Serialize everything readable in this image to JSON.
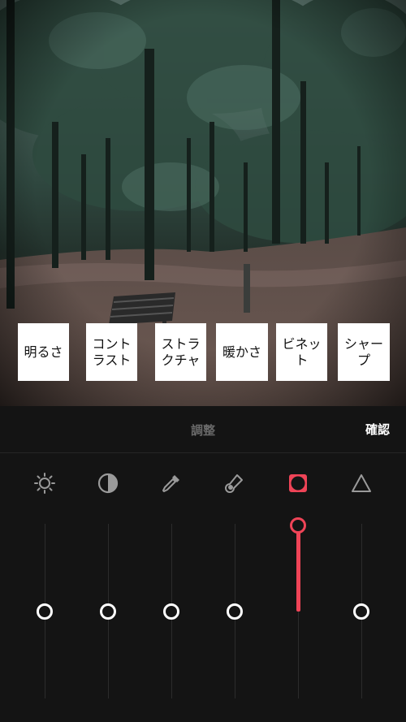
{
  "header": {
    "title": "調整",
    "confirm_label": "確認"
  },
  "adjustments": [
    {
      "label": "明るさ",
      "icon": "brightness-sun-icon",
      "value": 0.5,
      "active": false
    },
    {
      "label": "コントラスト",
      "icon": "contrast-icon",
      "value": 0.5,
      "active": false
    },
    {
      "label": "ストラクチャ",
      "icon": "eyedropper-icon",
      "value": 0.5,
      "active": false
    },
    {
      "label": "暖かさ",
      "icon": "thermometer-icon",
      "value": 0.5,
      "active": false
    },
    {
      "label": "ビネット",
      "icon": "vignette-icon",
      "value": 1.0,
      "active": true
    },
    {
      "label": "シャープ",
      "icon": "sharpen-triangle-icon",
      "value": 0.5,
      "active": false
    }
  ],
  "colors": {
    "accent": "#ef4457",
    "background": "#141414",
    "icon_inactive": "#9a9a9a"
  },
  "photo": {
    "description_icon": "forest-bench-photo"
  }
}
